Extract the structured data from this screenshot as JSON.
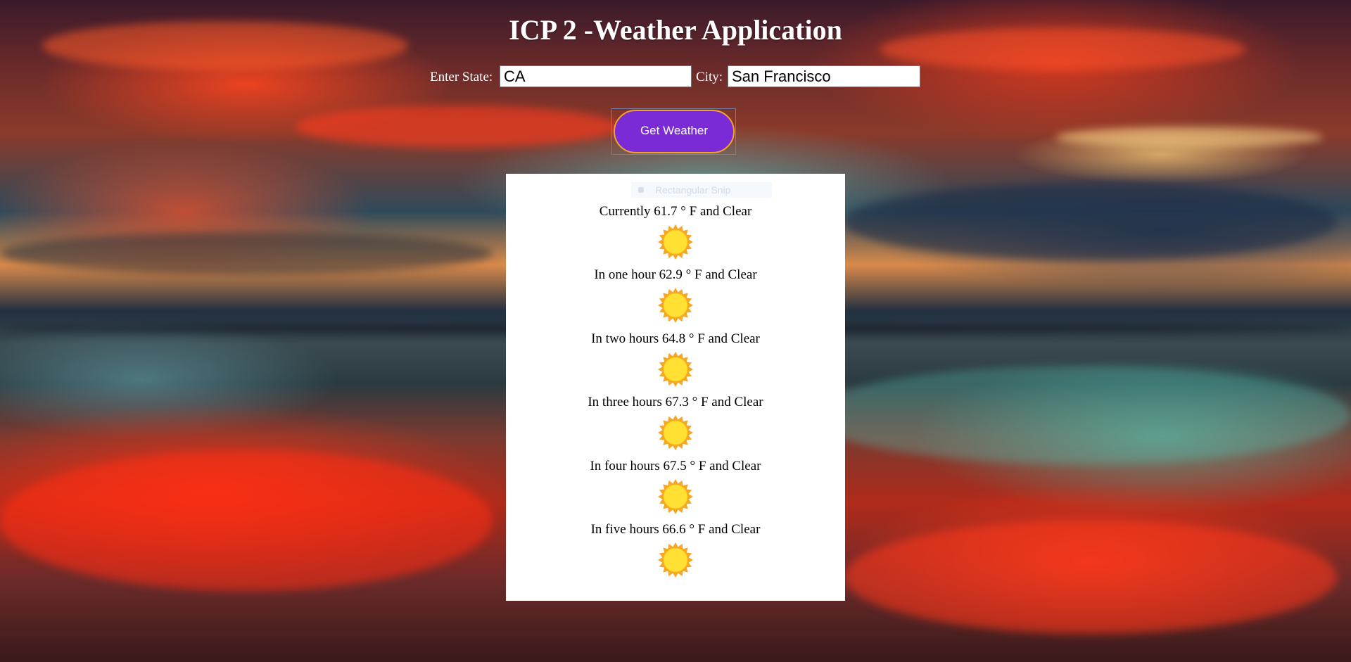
{
  "page": {
    "title": "ICP 2 -Weather Application"
  },
  "form": {
    "state_label": "Enter State:",
    "state_value": "CA",
    "city_label": "City:",
    "city_value": "San Francisco",
    "submit_label": "Get Weather"
  },
  "overlay": {
    "snip_label": "Rectangular Snip"
  },
  "forecasts": [
    {
      "text": "Currently 61.7 ° F and Clear",
      "icon": "sun-icon"
    },
    {
      "text": "In one hour 62.9 ° F and Clear",
      "icon": "sun-icon"
    },
    {
      "text": "In two hours 64.8 ° F and Clear",
      "icon": "sun-icon"
    },
    {
      "text": "In three hours 67.3 ° F and Clear",
      "icon": "sun-icon"
    },
    {
      "text": "In four hours 67.5 ° F and Clear",
      "icon": "sun-icon"
    },
    {
      "text": "In five hours 66.6 ° F and Clear",
      "icon": "sun-icon"
    }
  ],
  "colors": {
    "button_fill": "#7b2bd6",
    "button_border": "#f0a22a",
    "panel_background": "#ffffff",
    "sun_outer": "#f5a623",
    "sun_inner": "#ffe033"
  }
}
